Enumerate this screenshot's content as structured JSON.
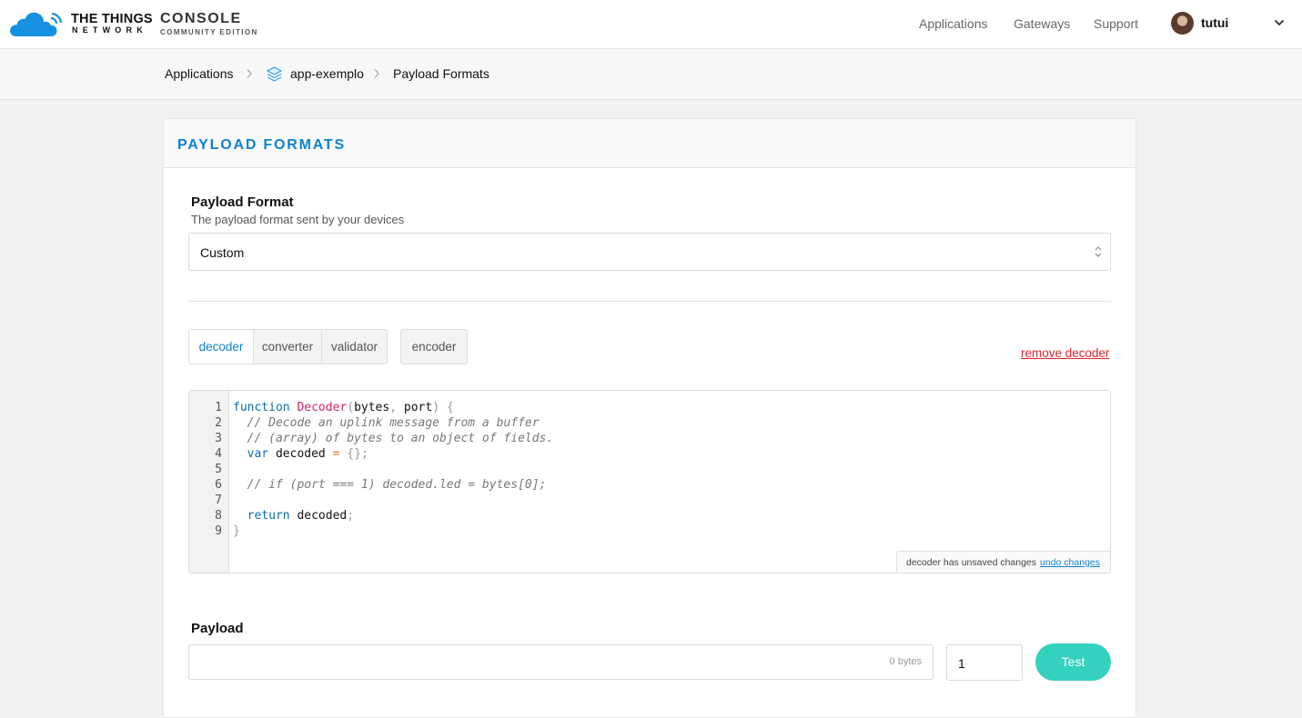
{
  "brand": {
    "name_line1": "THE THINGS",
    "name_line2": "NETWORK",
    "console": "CONSOLE",
    "edition": "COMMUNITY EDITION"
  },
  "nav": {
    "items": [
      "Applications",
      "Gateways",
      "Support"
    ],
    "username": "tutui"
  },
  "breadcrumb": {
    "items": [
      "Applications",
      "app-exemplo",
      "Payload Formats"
    ]
  },
  "card": {
    "title": "PAYLOAD FORMATS"
  },
  "payload_format": {
    "label": "Payload Format",
    "help": "The payload format sent by your devices",
    "selected": "Custom"
  },
  "tabs": {
    "group1": [
      "decoder",
      "converter",
      "validator"
    ],
    "group2": [
      "encoder"
    ],
    "active": "decoder"
  },
  "remove_link": "remove decoder",
  "editor": {
    "line_numbers": [
      "1",
      "2",
      "3",
      "4",
      "5",
      "6",
      "7",
      "8",
      "9"
    ],
    "unsaved_text": "decoder has unsaved changes",
    "undo_label": "undo changes"
  },
  "payload": {
    "label": "Payload",
    "bytes": "0 bytes",
    "port_value": "1",
    "test_label": "Test"
  },
  "colors": {
    "accent": "#0d83d0",
    "danger": "#e0262b",
    "test_button": "#34d1bf"
  }
}
